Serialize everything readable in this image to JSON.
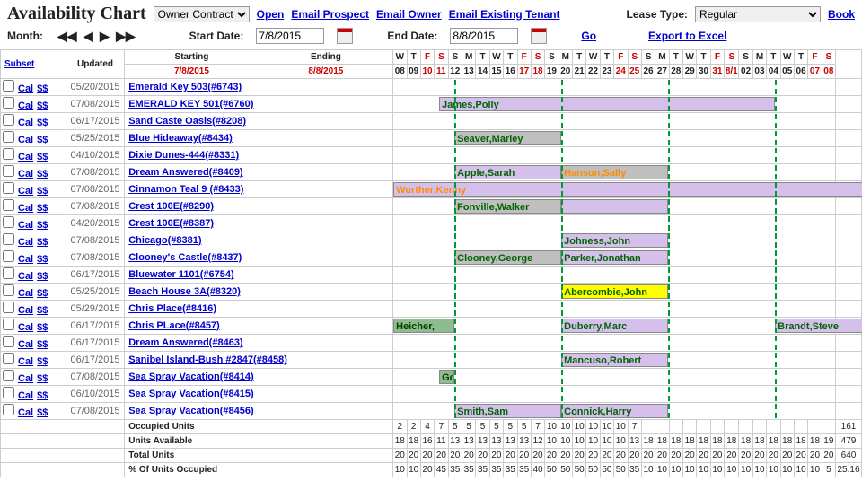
{
  "header": {
    "title": "Availability Chart",
    "dropdown1_value": "Owner Contract",
    "open": "Open",
    "email_prospect": "Email Prospect",
    "email_owner": "Email Owner",
    "email_existing": "Email Existing Tenant",
    "lease_type_label": "Lease Type:",
    "lease_type_value": "Regular",
    "book": "Book"
  },
  "navrow": {
    "month_label": "Month:",
    "start_label": "Start Date:",
    "start_value": "7/8/2015",
    "end_label": "End Date:",
    "end_value": "8/8/2015",
    "go": "Go",
    "export": "Export to Excel"
  },
  "columns": {
    "subset": "Subset",
    "updated": "Updated",
    "starting_label": "Starting",
    "starting_value": "7/8/2015",
    "ending_label": "Ending",
    "ending_value": "8/8/2015"
  },
  "days_dow": [
    "W",
    "T",
    "F",
    "S",
    "S",
    "M",
    "T",
    "W",
    "T",
    "F",
    "S",
    "S",
    "M",
    "T",
    "W",
    "T",
    "F",
    "S",
    "S",
    "M",
    "T",
    "W",
    "T",
    "F",
    "S",
    "S",
    "M",
    "T",
    "W",
    "T",
    "F",
    "S"
  ],
  "days_num": [
    "08",
    "09",
    "10",
    "11",
    "12",
    "13",
    "14",
    "15",
    "16",
    "17",
    "18",
    "19",
    "20",
    "21",
    "22",
    "23",
    "24",
    "25",
    "26",
    "27",
    "28",
    "29",
    "30",
    "31",
    "8/1",
    "02",
    "03",
    "04",
    "05",
    "06",
    "07",
    "08"
  ],
  "weekend_idx": [
    2,
    3,
    9,
    10,
    16,
    17,
    23,
    24,
    30,
    31
  ],
  "week_starts_idx": [
    4,
    11,
    18,
    25
  ],
  "rows": [
    {
      "updated": "05/20/2015",
      "prop": "Emerald Key 503(#6743)",
      "bars": []
    },
    {
      "updated": "07/08/2015",
      "prop": "EMERALD KEY 501(#6760)",
      "bars": [
        {
          "start": 3,
          "span": 22,
          "text": "James,Polly",
          "cls": "purple"
        }
      ]
    },
    {
      "updated": "06/17/2015",
      "prop": "Sand Caste Oasis(#8208)",
      "bars": []
    },
    {
      "updated": "05/25/2015",
      "prop": "Blue Hideaway(#8434)",
      "bars": [
        {
          "start": 4,
          "span": 7,
          "text": "Seaver,Marley",
          "cls": "gray green"
        }
      ]
    },
    {
      "updated": "04/10/2015",
      "prop": "Dixie Dunes-444(#8331)",
      "bars": []
    },
    {
      "updated": "07/08/2015",
      "prop": "Dream Answered(#8409)",
      "bars": [
        {
          "start": 4,
          "span": 7,
          "text": "Apple,Sarah",
          "cls": "purple green"
        },
        {
          "start": 11,
          "span": 7,
          "text": "Hanson,Sally",
          "cls": "gray orange"
        }
      ]
    },
    {
      "updated": "07/08/2015",
      "prop": "Cinnamon Teal 9 (#8433)",
      "bars": [
        {
          "start": 0,
          "span": 32,
          "text": "Wurther,Kenny",
          "cls": "purple orange"
        }
      ]
    },
    {
      "updated": "07/08/2015",
      "prop": "Crest 100E(#8290)",
      "bars": [
        {
          "start": 4,
          "span": 7,
          "text": "Fonville,Walker",
          "cls": "gray green"
        },
        {
          "start": 11,
          "span": 7,
          "text": "",
          "cls": "purple"
        }
      ]
    },
    {
      "updated": "04/20/2015",
      "prop": "Crest 100E(#8387)",
      "bars": []
    },
    {
      "updated": "07/08/2015",
      "prop": "Chicago(#8381)",
      "bars": [
        {
          "start": 11,
          "span": 7,
          "text": "Johness,John",
          "cls": "purple green"
        }
      ]
    },
    {
      "updated": "07/08/2015",
      "prop": "Clooney's Castle(#8437)",
      "bars": [
        {
          "start": 4,
          "span": 7,
          "text": "Clooney,George",
          "cls": "gray"
        },
        {
          "start": 11,
          "span": 7,
          "text": "Parker,Jonathan",
          "cls": "purple green"
        }
      ]
    },
    {
      "updated": "06/17/2015",
      "prop": "Bluewater 1101(#6754)",
      "bars": []
    },
    {
      "updated": "05/25/2015",
      "prop": "Beach House 3A(#8320)",
      "bars": [
        {
          "start": 11,
          "span": 7,
          "text": "Abercombie,John",
          "cls": "yellow"
        }
      ]
    },
    {
      "updated": "05/29/2015",
      "prop": "Chris Place(#8416)",
      "bars": []
    },
    {
      "updated": "06/17/2015",
      "prop": "Chris PLace(#8457)",
      "bars": [
        {
          "start": 0,
          "span": 4,
          "text": "Heicher,",
          "cls": "darkgreen"
        },
        {
          "start": 11,
          "span": 7,
          "text": "Duberry,Marc",
          "cls": "purple green"
        },
        {
          "start": 25,
          "span": 7,
          "text": "Brandt,Steve",
          "cls": "purple green"
        }
      ]
    },
    {
      "updated": "06/17/2015",
      "prop": "Dream Answered(#8463)",
      "bars": []
    },
    {
      "updated": "06/17/2015",
      "prop": "Sanibel Island-Bush #2847(#8458)",
      "bars": [
        {
          "start": 11,
          "span": 7,
          "text": "Mancuso,Robert",
          "cls": "purple green"
        }
      ]
    },
    {
      "updated": "07/08/2015",
      "prop": "Sea Spray Vacation(#8414)",
      "bars": [
        {
          "start": 3,
          "span": 1,
          "text": "Gome",
          "cls": "darkgreen"
        }
      ]
    },
    {
      "updated": "06/10/2015",
      "prop": "Sea Spray Vacation(#8415)",
      "bars": []
    },
    {
      "updated": "07/08/2015",
      "prop": "Sea Spray Vacation(#8456)",
      "bars": [
        {
          "start": 4,
          "span": 7,
          "text": "Smith,Sam",
          "cls": "purple green"
        },
        {
          "start": 11,
          "span": 7,
          "text": "Connick,Harry",
          "cls": "purple green"
        }
      ]
    }
  ],
  "footer": {
    "rows": [
      {
        "label": "Occupied Units",
        "vals": [
          "2",
          "2",
          "4",
          "7",
          "5",
          "5",
          "5",
          "5",
          "5",
          "5",
          "7",
          "10",
          "10",
          "10",
          "10",
          "10",
          "10",
          "7",
          "",
          "",
          "",
          "",
          "",
          "",
          "",
          "",
          "",
          "",
          "",
          "",
          "",
          ""
        ],
        "total": "161"
      },
      {
        "label": "Units Available",
        "vals": [
          "18",
          "18",
          "16",
          "11",
          "13",
          "13",
          "13",
          "13",
          "13",
          "13",
          "12",
          "10",
          "10",
          "10",
          "10",
          "10",
          "10",
          "13",
          "18",
          "18",
          "18",
          "18",
          "18",
          "18",
          "18",
          "18",
          "18",
          "18",
          "18",
          "18",
          "18",
          "19"
        ],
        "total": "479"
      },
      {
        "label": "Total Units",
        "vals": [
          "20",
          "20",
          "20",
          "20",
          "20",
          "20",
          "20",
          "20",
          "20",
          "20",
          "20",
          "20",
          "20",
          "20",
          "20",
          "20",
          "20",
          "20",
          "20",
          "20",
          "20",
          "20",
          "20",
          "20",
          "20",
          "20",
          "20",
          "20",
          "20",
          "20",
          "20",
          "20"
        ],
        "total": "640"
      },
      {
        "label": "% Of Units Occupied",
        "vals": [
          "10",
          "10",
          "20",
          "45",
          "35",
          "35",
          "35",
          "35",
          "35",
          "35",
          "40",
          "50",
          "50",
          "50",
          "50",
          "50",
          "50",
          "35",
          "10",
          "10",
          "10",
          "10",
          "10",
          "10",
          "10",
          "10",
          "10",
          "10",
          "10",
          "10",
          "10",
          "5"
        ],
        "total": "25.16"
      }
    ]
  },
  "labels": {
    "cal": "Cal",
    "dd": "$$"
  }
}
